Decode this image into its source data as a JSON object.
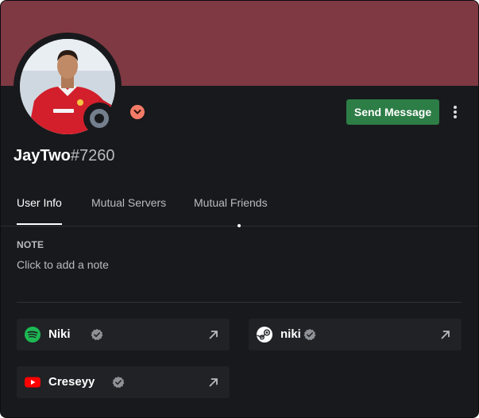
{
  "profile": {
    "username": "JayTwo",
    "discriminator": "#7260",
    "status": "offline",
    "banner_color": "#7f3942",
    "avatar_description": "player in red football jersey"
  },
  "actions": {
    "send_message_label": "Send Message",
    "more_icon": "more-vertical-icon"
  },
  "tabs": [
    {
      "label": "User Info",
      "active": true
    },
    {
      "label": "Mutual Servers",
      "active": false
    },
    {
      "label": "Mutual Friends",
      "active": false
    }
  ],
  "note": {
    "heading": "NOTE",
    "placeholder": "Click to add a note"
  },
  "connected_accounts": [
    {
      "service": "spotify-icon",
      "name": "Niki",
      "verified": true
    },
    {
      "service": "steam-icon",
      "name": "niki",
      "verified": true
    },
    {
      "service": "youtube-icon",
      "name": "Creseyy",
      "verified": true
    }
  ],
  "colors": {
    "accent_green": "#2d7d46",
    "badge": "#f47b67",
    "background": "#18191c",
    "card": "#202225"
  }
}
